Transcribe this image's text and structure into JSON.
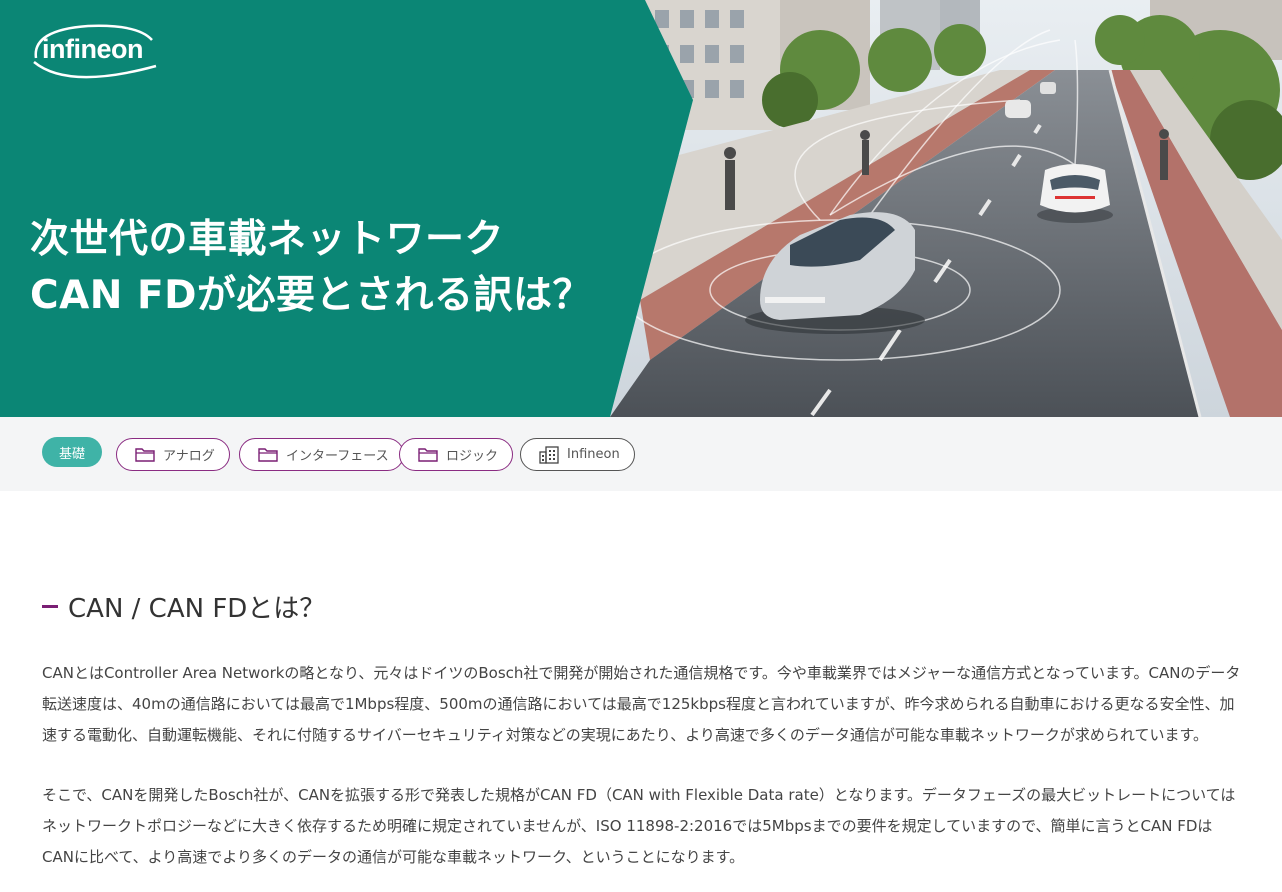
{
  "hero": {
    "logo_text": "infineon",
    "title_line1": "次世代の車載ネットワーク",
    "title_line2": "CAN FDが必要とされる訳は？"
  },
  "tags": {
    "primary": "基礎",
    "items": [
      {
        "label": "アナログ",
        "icon": "folder-icon"
      },
      {
        "label": "インターフェース",
        "icon": "folder-icon"
      },
      {
        "label": "ロジック",
        "icon": "folder-icon"
      },
      {
        "label": "Infineon",
        "icon": "building-icon"
      }
    ]
  },
  "article": {
    "heading": "CAN / CAN FDとは？",
    "paragraphs": [
      "CANとはController Area Networkの略となり、元々はドイツのBosch社で開発が開始された通信規格です。今や車載業界ではメジャーな通信方式となっています。CANのデータ転送速度は、40mの通信路においては最高で1Mbps程度、500mの通信路においては最高で125kbps程度と言われていますが、昨今求められる自動車における更なる安全性、加速する電動化、自動運転機能、それに付随するサイバーセキュリティ対策などの実現にあたり、より高速で多くのデータ通信が可能な車載ネットワークが求められています。",
      "そこで、CANを開発したBosch社が、CANを拡張する形で発表した規格がCAN FD（CAN with Flexible Data rate）となります。データフェーズの最大ビットレートについてはネットワークトポロジーなどに大きく依存するため明確に規定されていませんが、ISO 11898-2:2016では5Mbpsまでの要件を規定していますので、簡単に言うとCAN FDはCANに比べて、より高速でより多くのデータの通信が可能な車載ネットワーク、ということになります。"
    ]
  },
  "colors": {
    "teal": "#0b8675",
    "tag_teal": "#3fb3a7",
    "purple": "#8a2c82"
  }
}
